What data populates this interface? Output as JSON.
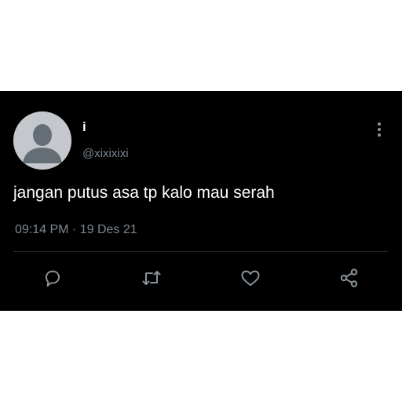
{
  "tweet": {
    "display_name": "i",
    "handle": "@xixixixi",
    "text": "jangan putus asa tp kalo mau serah",
    "time": "09:14 PM",
    "separator": " · ",
    "date": "19 Des 21"
  },
  "icons": {
    "avatar": "default-avatar-icon",
    "more": "more-vertical-icon",
    "reply": "reply-icon",
    "retweet": "retweet-icon",
    "like": "heart-icon",
    "share": "share-icon"
  },
  "colors": {
    "background": "#000000",
    "text_primary": "#ffffff",
    "text_secondary": "#7c8791",
    "icon": "#8a939b"
  }
}
